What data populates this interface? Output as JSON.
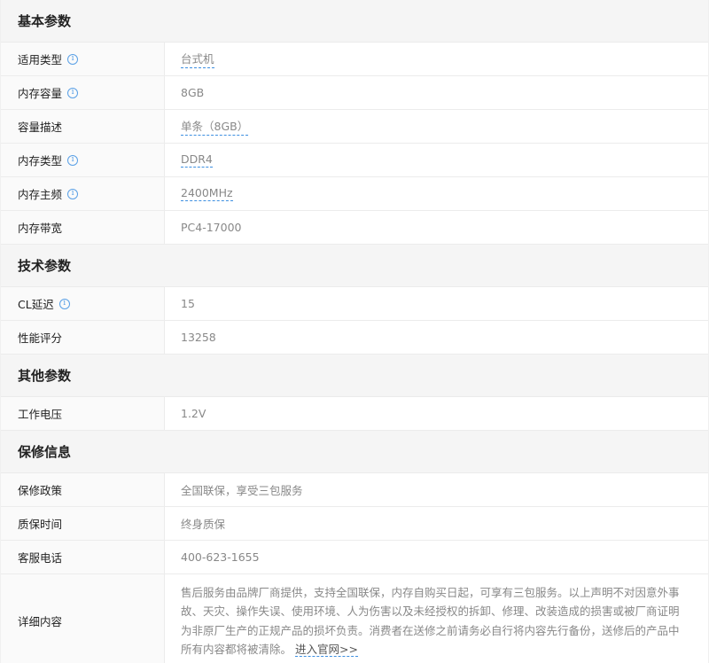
{
  "sections": [
    {
      "title": "基本参数",
      "rows": [
        {
          "key": "适用类型",
          "info": true,
          "value": "台式机",
          "dashed": true
        },
        {
          "key": "内存容量",
          "info": true,
          "value": "8GB",
          "dashed": false
        },
        {
          "key": "容量描述",
          "info": false,
          "value": "单条（8GB）",
          "dashed": true
        },
        {
          "key": "内存类型",
          "info": true,
          "value": "DDR4",
          "dashed": true
        },
        {
          "key": "内存主频",
          "info": true,
          "value": "2400MHz",
          "dashed": true
        },
        {
          "key": "内存带宽",
          "info": false,
          "value": "PC4-17000",
          "dashed": false
        }
      ]
    },
    {
      "title": "技术参数",
      "rows": [
        {
          "key": "CL延迟",
          "info": true,
          "value": "15",
          "dashed": false
        },
        {
          "key": "性能评分",
          "info": false,
          "value": "13258",
          "dashed": false
        }
      ]
    },
    {
      "title": "其他参数",
      "rows": [
        {
          "key": "工作电压",
          "info": false,
          "value": "1.2V",
          "dashed": false
        }
      ]
    },
    {
      "title": "保修信息",
      "rows": [
        {
          "key": "保修政策",
          "info": false,
          "value": "全国联保，享受三包服务",
          "dashed": false
        },
        {
          "key": "质保时间",
          "info": false,
          "value": "终身质保",
          "dashed": false
        },
        {
          "key": "客服电话",
          "info": false,
          "value": "400-623-1655",
          "dashed": false
        }
      ]
    }
  ],
  "detail": {
    "key": "详细内容",
    "text": "售后服务由品牌厂商提供，支持全国联保，内存自购买日起，可享有三包服务。以上声明不对因意外事故、天灾、操作失误、使用环境、人为伤害以及未经授权的拆卸、修理、改装造成的损害或被厂商证明为非原厂生产的正规产品的损坏负责。消费者在送修之前请务必自行将内容先行备份，送修后的产品中所有内容都将被清除。",
    "link": "进入官网>>"
  },
  "info_glyph": "i",
  "colors": {
    "accent": "#3d8fe0",
    "header_bg": "#f5f5f5",
    "key_bg": "#fafafa"
  }
}
